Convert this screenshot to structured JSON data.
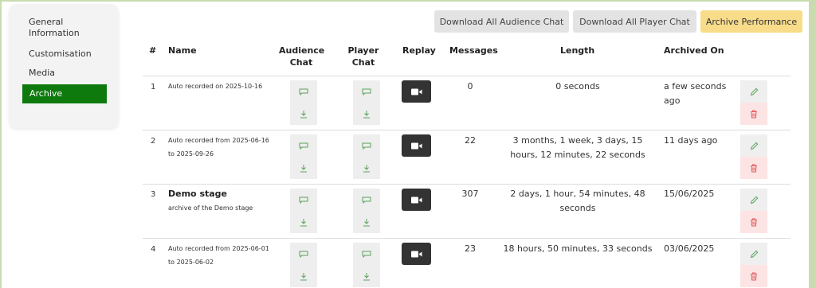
{
  "sidebar": {
    "items": [
      {
        "label": "General Information"
      },
      {
        "label": "Customisation"
      },
      {
        "label": "Media"
      },
      {
        "label": "Archive",
        "active": true
      }
    ]
  },
  "toolbar": {
    "download_audience_label": "Download All Audience Chat",
    "download_player_label": "Download All Player Chat",
    "archive_performance_label": "Archive Performance"
  },
  "table": {
    "headers": {
      "index": "#",
      "name": "Name",
      "audience_chat": "Audience Chat",
      "player_chat": "Player Chat",
      "replay": "Replay",
      "messages": "Messages",
      "length": "Length",
      "archived_on": "Archived On"
    },
    "rows": [
      {
        "index": "1",
        "name": "Auto recorded on 2025-10-16",
        "description": "",
        "messages": "0",
        "length": "0 seconds",
        "archived_on": "a few seconds ago"
      },
      {
        "index": "2",
        "name": "Auto recorded from 2025-06-16 to 2025-09-26",
        "description": "",
        "messages": "22",
        "length": "3 months, 1 week, 3 days, 15 hours, 12 minutes, 22 seconds",
        "archived_on": "11 days ago"
      },
      {
        "index": "3",
        "name": "Demo stage",
        "description": "archive of the Demo stage",
        "messages": "307",
        "length": "2 days, 1 hour, 54 minutes, 48 seconds",
        "archived_on": "15/06/2025"
      },
      {
        "index": "4",
        "name": "Auto recorded from 2025-06-01 to 2025-06-02",
        "description": "",
        "messages": "23",
        "length": "18 hours, 50 minutes, 33 seconds",
        "archived_on": "03/06/2025"
      }
    ]
  },
  "colors": {
    "accent_green": "#0e7a0d",
    "archive_button": "#f8dc8a",
    "delete_bg": "#fce4e4",
    "icon_green": "#5aa35a",
    "icon_red": "#e05a5a"
  }
}
